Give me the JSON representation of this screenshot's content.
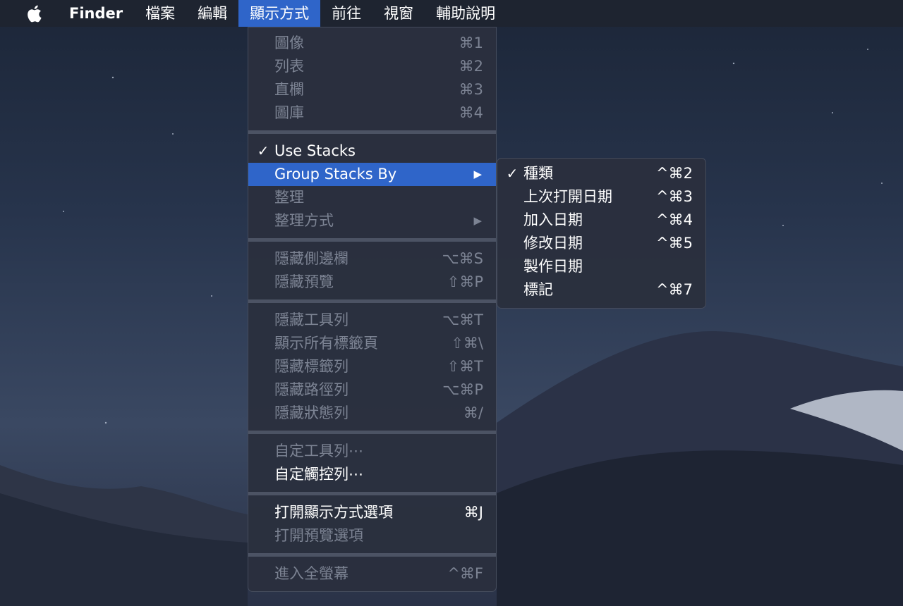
{
  "menubar": {
    "items": [
      "Finder",
      "檔案",
      "編輯",
      "顯示方式",
      "前往",
      "視窗",
      "輔助說明"
    ]
  },
  "view_menu": {
    "items": [
      {
        "label": "圖像",
        "shortcut": "⌘1"
      },
      {
        "label": "列表",
        "shortcut": "⌘2"
      },
      {
        "label": "直欄",
        "shortcut": "⌘3"
      },
      {
        "label": "圖庫",
        "shortcut": "⌘4"
      },
      {
        "label": "Use Stacks",
        "check": "✓"
      },
      {
        "label": "Group Stacks By",
        "arrow": "▶"
      },
      {
        "label": "整理"
      },
      {
        "label": "整理方式",
        "arrow": "▶"
      },
      {
        "label": "隱藏側邊欄",
        "shortcut": "⌥⌘S"
      },
      {
        "label": "隱藏預覽",
        "shortcut": "⇧⌘P"
      },
      {
        "label": "隱藏工具列",
        "shortcut": "⌥⌘T"
      },
      {
        "label": "顯示所有標籤頁",
        "shortcut": "⇧⌘\\"
      },
      {
        "label": "隱藏標籤列",
        "shortcut": "⇧⌘T"
      },
      {
        "label": "隱藏路徑列",
        "shortcut": "⌥⌘P"
      },
      {
        "label": "隱藏狀態列",
        "shortcut": "⌘/"
      },
      {
        "label": "自定工具列⋯"
      },
      {
        "label": "自定觸控列⋯"
      },
      {
        "label": "打開顯示方式選項",
        "shortcut": "⌘J"
      },
      {
        "label": "打開預覽選項"
      },
      {
        "label": "進入全螢幕",
        "shortcut": "^⌘F"
      }
    ]
  },
  "submenu": {
    "items": [
      {
        "label": "種類",
        "shortcut": "^⌘2",
        "check": "✓"
      },
      {
        "label": "上次打開日期",
        "shortcut": "^⌘3"
      },
      {
        "label": "加入日期",
        "shortcut": "^⌘4"
      },
      {
        "label": "修改日期",
        "shortcut": "^⌘5"
      },
      {
        "label": "製作日期"
      },
      {
        "label": "標記",
        "shortcut": "^⌘7"
      }
    ]
  },
  "colors": {
    "highlight": "#2f65c9",
    "menu_bg": "#2a303e",
    "disabled_text": "#7c8393",
    "text": "#ffffff"
  }
}
